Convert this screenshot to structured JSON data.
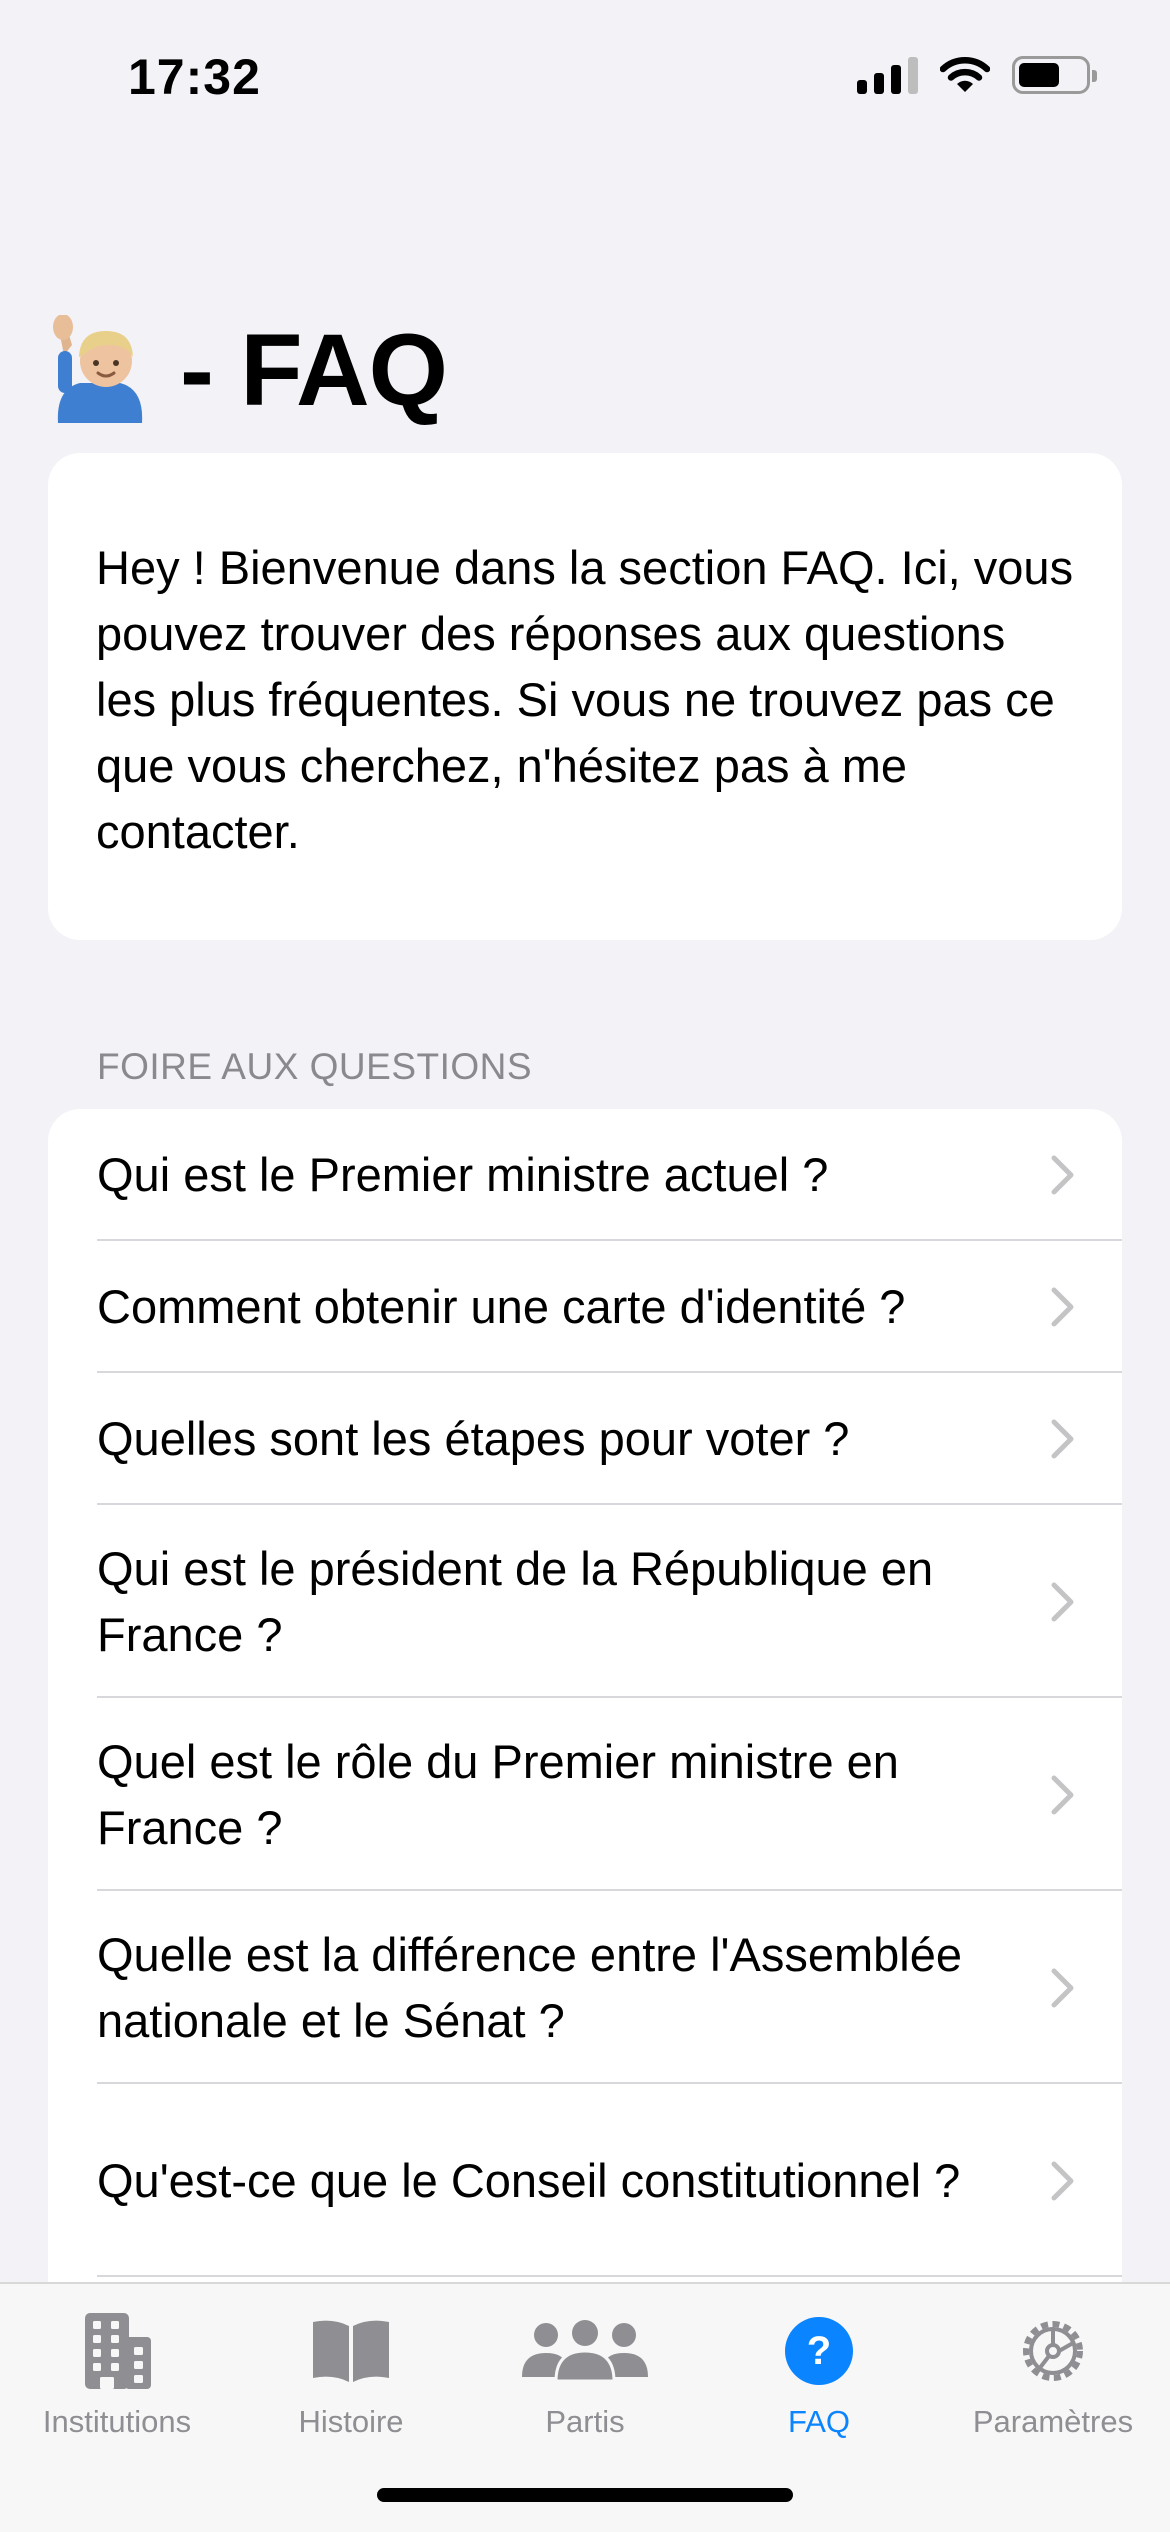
{
  "status_bar": {
    "time": "17:32",
    "icons": [
      "cellular-signal-icon",
      "wifi-icon",
      "battery-icon"
    ]
  },
  "header": {
    "emoji": "raising-hand-emoji",
    "title": "- FAQ"
  },
  "intro": {
    "text": "Hey  ! Bienvenue dans la section FAQ. Ici, vous pouvez trouver des réponses aux questions les plus fréquentes. Si vous ne trouvez pas ce que vous cherchez, n'hésitez pas à me contacter."
  },
  "faq": {
    "section_title": "FOIRE AUX QUESTIONS",
    "items": [
      {
        "question": "Qui est le Premier ministre actuel ?"
      },
      {
        "question": "Comment obtenir une carte d'identité ?"
      },
      {
        "question": "Quelles sont les étapes pour voter ?"
      },
      {
        "question": "Qui est le président de la République en France ?"
      },
      {
        "question": "Quel est le rôle du Premier ministre en France ?"
      },
      {
        "question": "Quelle est la différence entre l'Assemblée nationale et le Sénat ?"
      },
      {
        "question": "Qu'est-ce que le Conseil constitutionnel ?"
      }
    ]
  },
  "tabs": [
    {
      "label": "Institutions",
      "icon": "building-icon"
    },
    {
      "label": "Histoire",
      "icon": "book-icon"
    },
    {
      "label": "Partis",
      "icon": "people-icon"
    },
    {
      "label": "FAQ",
      "icon": "question-circle-icon",
      "active": true
    },
    {
      "label": "Paramètres",
      "icon": "gear-icon"
    }
  ],
  "colors": {
    "background": "#f2f2f7",
    "accent": "#0a84ff",
    "inactive": "#8e8e93",
    "card": "#ffffff"
  }
}
